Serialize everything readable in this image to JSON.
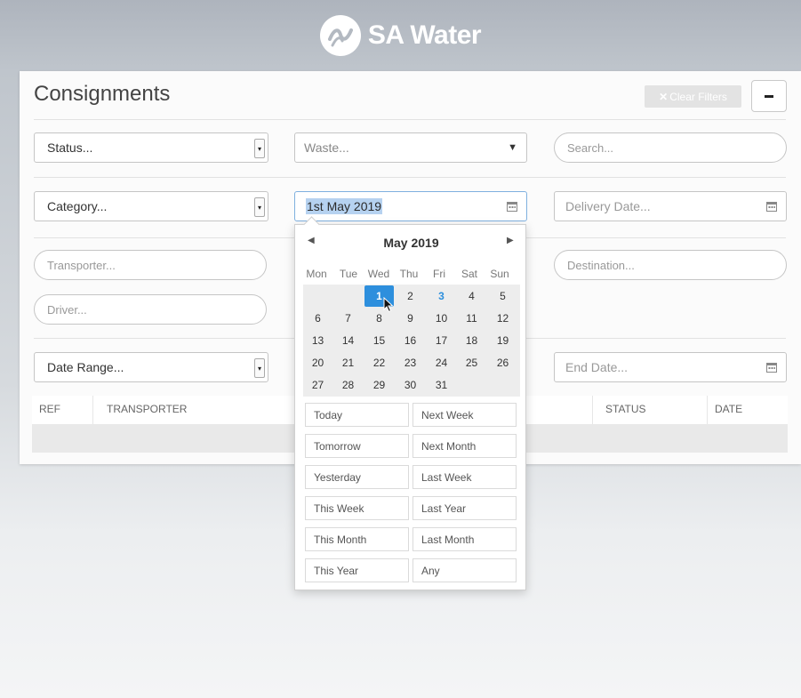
{
  "header": {
    "brand": "SA Water",
    "logo_icon": "sa-water-logo-icon"
  },
  "page": {
    "title": "Consignments",
    "clear_filters_label": "Clear Filters",
    "collapse_label": "−"
  },
  "filters": {
    "status_placeholder": "Status...",
    "waste_placeholder": "Waste...",
    "search_placeholder": "Search...",
    "category_placeholder": "Category...",
    "start_date_value": "1st May 2019",
    "delivery_date_placeholder": "Delivery Date...",
    "transporter_placeholder": "Transporter...",
    "destination_placeholder": "Destination...",
    "driver_placeholder": "Driver...",
    "date_range_placeholder": "Date Range...",
    "end_date_placeholder": "End Date..."
  },
  "table": {
    "columns": [
      "REF",
      "TRANSPORTER",
      "STATUS",
      "DATE"
    ]
  },
  "datepicker": {
    "month_label": "May 2019",
    "prev_icon": "chevron-left-icon",
    "next_icon": "chevron-right-icon",
    "weekdays": [
      "Mon",
      "Tue",
      "Wed",
      "Thu",
      "Fri",
      "Sat",
      "Sun"
    ],
    "weeks": [
      [
        "",
        "",
        "1",
        "2",
        "3",
        "4",
        "5"
      ],
      [
        "6",
        "7",
        "8",
        "9",
        "10",
        "11",
        "12"
      ],
      [
        "13",
        "14",
        "15",
        "16",
        "17",
        "18",
        "19"
      ],
      [
        "20",
        "21",
        "22",
        "23",
        "24",
        "25",
        "26"
      ],
      [
        "27",
        "28",
        "29",
        "30",
        "31",
        "",
        ""
      ]
    ],
    "selected_day": "1",
    "highlighted_day": "3",
    "ranges": [
      [
        "Today",
        "Next Week"
      ],
      [
        "Tomorrow",
        "Next Month"
      ],
      [
        "Yesterday",
        "Last Week"
      ],
      [
        "This Week",
        "Last Year"
      ],
      [
        "This Month",
        "Last Month"
      ],
      [
        "This Year",
        "Any"
      ]
    ]
  },
  "colors": {
    "accent": "#2d8fdd",
    "header_bg": "#b3b9c1",
    "panel_bg": "#fbfbfb"
  }
}
